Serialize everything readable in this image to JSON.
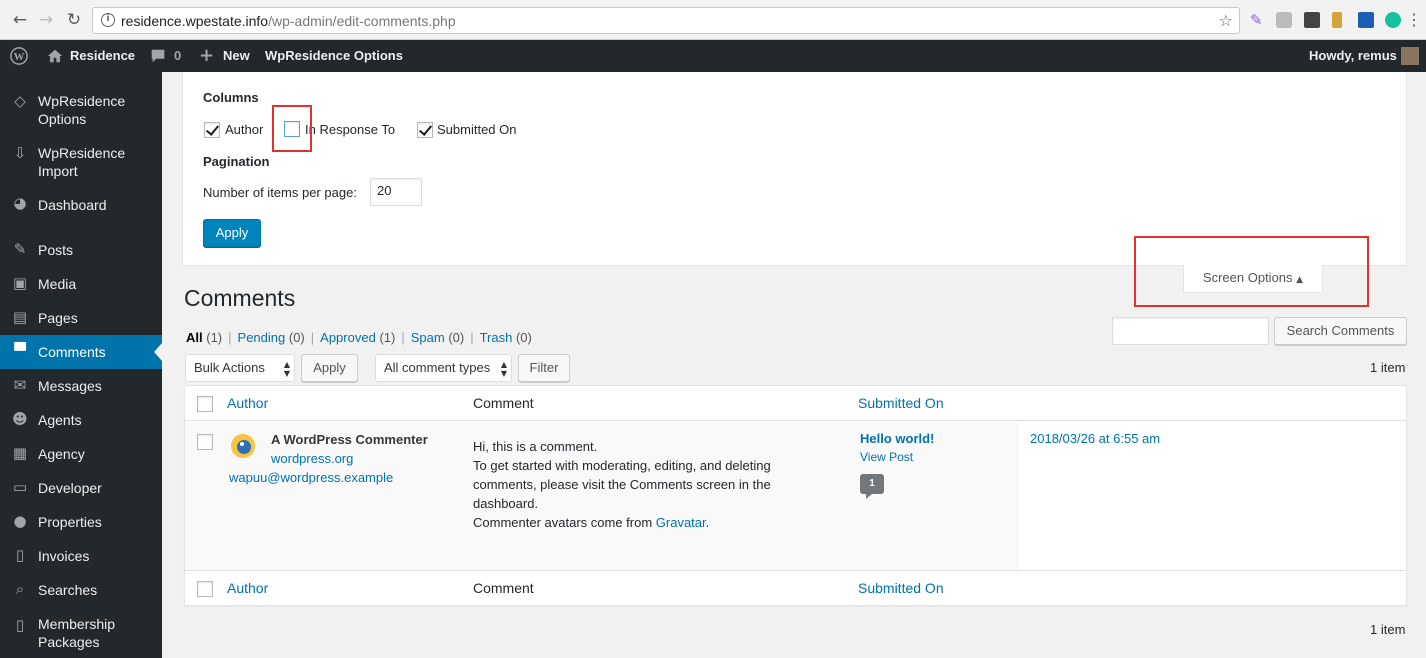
{
  "browser": {
    "url_host": "residence.wpestate.info",
    "url_path": "/wp-admin/edit-comments.php"
  },
  "adminbar": {
    "site_name": "Residence",
    "comments_count": "0",
    "new_label": "New",
    "options_label": "WpResidence Options",
    "howdy": "Howdy, remus"
  },
  "sidebar": {
    "items": [
      {
        "label_line1": "WpResidence",
        "label_line2": "Options",
        "icon": "diamond-icon"
      },
      {
        "label_line1": "WpResidence",
        "label_line2": "Import",
        "icon": "import-icon"
      },
      {
        "label": "Dashboard",
        "icon": "dashboard-icon"
      },
      {
        "label": "Posts",
        "icon": "pin-icon"
      },
      {
        "label": "Media",
        "icon": "media-icon"
      },
      {
        "label": "Pages",
        "icon": "pages-icon"
      },
      {
        "label": "Comments",
        "icon": "comment-icon"
      },
      {
        "label": "Messages",
        "icon": "envelope-icon"
      },
      {
        "label": "Agents",
        "icon": "agents-icon"
      },
      {
        "label": "Agency",
        "icon": "building-icon"
      },
      {
        "label": "Developer",
        "icon": "developer-icon"
      },
      {
        "label": "Properties",
        "icon": "location-icon"
      },
      {
        "label": "Invoices",
        "icon": "invoice-icon"
      },
      {
        "label": "Searches",
        "icon": "search-icon"
      },
      {
        "label_line1": "Membership",
        "label_line2": "Packages",
        "icon": "package-icon"
      }
    ]
  },
  "screen_options": {
    "columns_heading": "Columns",
    "col_author": "Author",
    "col_in_response_to": "In Response To",
    "col_submitted_on": "Submitted On",
    "pagination_heading": "Pagination",
    "items_per_page_label": "Number of items per page:",
    "items_per_page_value": "20",
    "apply_label": "Apply",
    "tab_label": "Screen Options"
  },
  "page": {
    "title": "Comments",
    "filters": {
      "all": "All",
      "all_count": "(1)",
      "pending": "Pending",
      "pending_count": "(0)",
      "approved": "Approved",
      "approved_count": "(1)",
      "spam": "Spam",
      "spam_count": "(0)",
      "trash": "Trash",
      "trash_count": "(0)"
    },
    "search_button": "Search Comments",
    "bulk_actions": "Bulk Actions",
    "apply_label": "Apply",
    "comment_types": "All comment types",
    "filter_label": "Filter",
    "item_count": "1 item"
  },
  "table": {
    "headers": {
      "author": "Author",
      "comment": "Comment",
      "submitted_on": "Submitted On"
    },
    "row": {
      "author_name": "A WordPress Commenter",
      "author_url": "wordpress.org",
      "author_email": "wapuu@wordpress.example",
      "comment_line1": "Hi, this is a comment.",
      "comment_line2": "To get started with moderating, editing, and deleting",
      "comment_line3": "comments, please visit the Comments screen in the",
      "comment_line4": "dashboard.",
      "comment_line5_pre": "Commenter avatars come from ",
      "comment_line5_link": "Gravatar",
      "comment_line5_post": ".",
      "post_title": "Hello world!",
      "view_post": "View Post",
      "comment_bubble": "1",
      "date": "2018/03/26 at 6:55 am"
    }
  },
  "colors": {
    "accent": "#0073aa",
    "sidebar_bg": "#23282d",
    "highlight_box": "#e2322f"
  }
}
